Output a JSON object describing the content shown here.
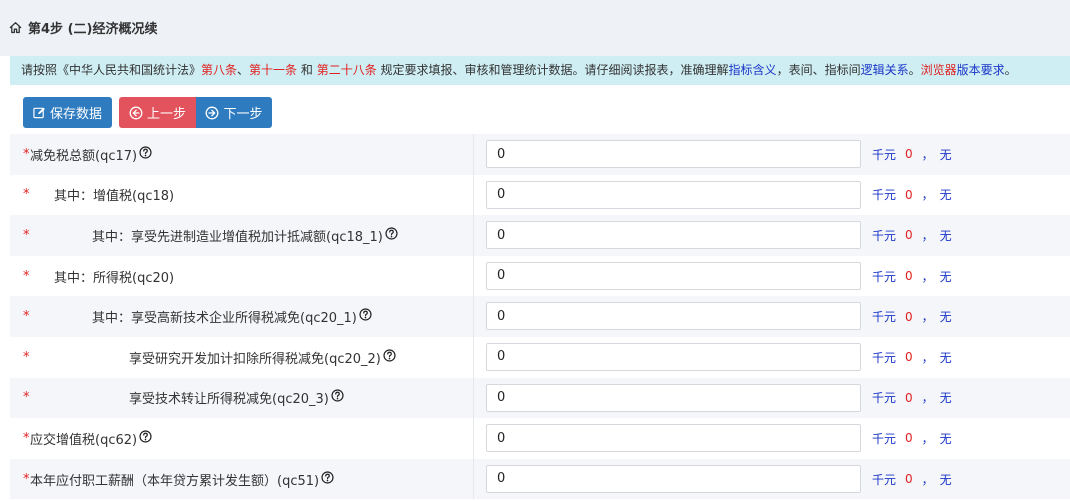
{
  "header": {
    "title": "第4步 (二)经济概况续"
  },
  "notice": {
    "part1": "请按照《中华人民共和国统计法》",
    "law1": "第八条",
    "sep1": "、",
    "law2": "第十一条",
    "and": " 和 ",
    "law3": "第二十八条",
    "part2": " 规定要求填报、审核和管理统计数据。请仔细阅读报表，准确理解",
    "link1": "指标含义",
    "part3": "，表间、指标间",
    "link2": "逻辑关系",
    "part4": "。",
    "link3": "浏览器",
    "link4": "版本要求",
    "part5": "。"
  },
  "toolbar": {
    "save_label": "保存数据",
    "prev_label": "上一步",
    "next_label": "下一步"
  },
  "rows": [
    {
      "star": "*",
      "label": "减免税总额(qc17)",
      "help": true,
      "value": "0",
      "unit": "千元",
      "count": "0",
      "comma": "，",
      "note": "无"
    },
    {
      "star": "*",
      "label": "其中：增值税(qc18)",
      "help": false,
      "value": "0",
      "unit": "千元",
      "count": "0",
      "comma": "，",
      "note": "无"
    },
    {
      "star": "*",
      "label": "其中：享受先进制造业增值税加计抵减额(qc18_1)",
      "help": true,
      "value": "0",
      "unit": "千元",
      "count": "0",
      "comma": "，",
      "note": "无"
    },
    {
      "star": "*",
      "label": "其中：所得税(qc20)",
      "help": false,
      "value": "0",
      "unit": "千元",
      "count": "0",
      "comma": "，",
      "note": "无"
    },
    {
      "star": "*",
      "label": "其中：享受高新技术企业所得税减免(qc20_1)",
      "help": true,
      "value": "0",
      "unit": "千元",
      "count": "0",
      "comma": "，",
      "note": "无"
    },
    {
      "star": "*",
      "label": "享受研究开发加计扣除所得税减免(qc20_2)",
      "help": true,
      "value": "0",
      "unit": "千元",
      "count": "0",
      "comma": "，",
      "note": "无"
    },
    {
      "star": "*",
      "label": "享受技术转让所得税减免(qc20_3)",
      "help": true,
      "value": "0",
      "unit": "千元",
      "count": "0",
      "comma": "，",
      "note": "无"
    },
    {
      "star": "*",
      "label": "应交增值税(qc62)",
      "help": true,
      "value": "0",
      "unit": "千元",
      "count": "0",
      "comma": "，",
      "note": "无"
    },
    {
      "star": "*",
      "label": "本年应付职工薪酬（本年贷方累计发生额）(qc51)",
      "help": true,
      "value": "0",
      "unit": "千元",
      "count": "0",
      "comma": "，",
      "note": "无"
    }
  ],
  "icons": {
    "home": "home-icon",
    "save": "edit-icon",
    "prev": "circle-arrow-left-icon",
    "next": "circle-arrow-right-icon",
    "help": "question-circle-icon"
  },
  "colors": {
    "primary": "#2f7bbf",
    "danger": "#e2535d",
    "required": "#e02020",
    "link": "#1a35c8",
    "notice_bg": "#cfeef3"
  }
}
